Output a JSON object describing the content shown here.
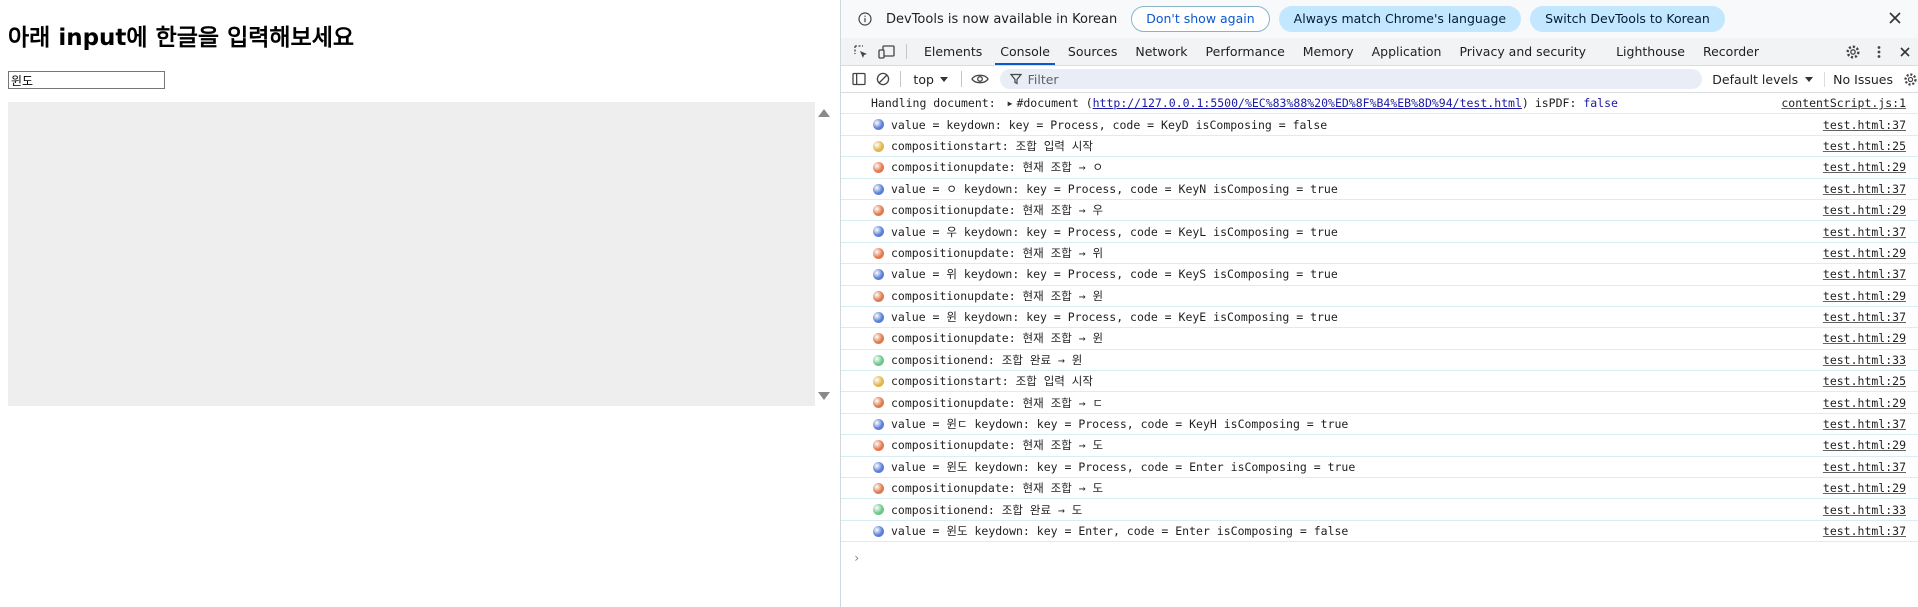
{
  "page": {
    "heading": "아래 input에 한글을 입력해보세요",
    "input_value": "윈도"
  },
  "devtools": {
    "infobar": {
      "message": "DevTools is now available in Korean",
      "dont_show_label": "Don't show again",
      "match_language_label": "Always match Chrome's language",
      "switch_label": "Switch DevTools to Korean"
    },
    "tabs": [
      {
        "label": "Elements"
      },
      {
        "label": "Console"
      },
      {
        "label": "Sources"
      },
      {
        "label": "Network"
      },
      {
        "label": "Performance"
      },
      {
        "label": "Memory"
      },
      {
        "label": "Application"
      },
      {
        "label": "Privacy and security"
      },
      {
        "label": "Lighthouse"
      },
      {
        "label": "Recorder"
      }
    ],
    "active_tab": "Console",
    "toolbar": {
      "context": "top",
      "filter_placeholder": "Filter",
      "levels": "Default levels",
      "issues": "No Issues"
    },
    "doc_row": {
      "label": "Handling document:",
      "node": "#document (",
      "url": "http://127.0.0.1:5500/%EC%83%88%20%ED%8F%B4%EB%8D%94/test.html",
      "close_paren": ")",
      "ispdf_label": "isPDF:",
      "ispdf_value": "false",
      "source": "contentScript.js:1"
    },
    "colors": {
      "keydown": "#5b7fd6",
      "compositionstart": "#e0b64a",
      "compositionupdate": "#e07a4e",
      "compositionend": "#6cc78a",
      "accent": "#0b57d0"
    },
    "logs": [
      {
        "kind": "keydown",
        "text": "value =  keydown: key = Process, code = KeyD isComposing = false",
        "source": "test.html:37"
      },
      {
        "kind": "compositionstart",
        "text": "compositionstart: 조합 입력 시작",
        "source": "test.html:25"
      },
      {
        "kind": "compositionupdate",
        "text": "compositionupdate: 현재 조합 → ㅇ",
        "source": "test.html:29"
      },
      {
        "kind": "keydown",
        "text": "value = ㅇ keydown: key = Process, code = KeyN isComposing = true",
        "source": "test.html:37"
      },
      {
        "kind": "compositionupdate",
        "text": "compositionupdate: 현재 조합 → 우",
        "source": "test.html:29"
      },
      {
        "kind": "keydown",
        "text": "value = 우 keydown: key = Process, code = KeyL isComposing = true",
        "source": "test.html:37"
      },
      {
        "kind": "compositionupdate",
        "text": "compositionupdate: 현재 조합 → 위",
        "source": "test.html:29"
      },
      {
        "kind": "keydown",
        "text": "value = 위 keydown: key = Process, code = KeyS isComposing = true",
        "source": "test.html:37"
      },
      {
        "kind": "compositionupdate",
        "text": "compositionupdate: 현재 조합 → 윈",
        "source": "test.html:29"
      },
      {
        "kind": "keydown",
        "text": "value = 윈 keydown: key = Process, code = KeyE isComposing = true",
        "source": "test.html:37"
      },
      {
        "kind": "compositionupdate",
        "text": "compositionupdate: 현재 조합 → 윈",
        "source": "test.html:29"
      },
      {
        "kind": "compositionend",
        "text": "compositionend: 조합 완료 → 윈",
        "source": "test.html:33"
      },
      {
        "kind": "compositionstart",
        "text": "compositionstart: 조합 입력 시작",
        "source": "test.html:25"
      },
      {
        "kind": "compositionupdate",
        "text": "compositionupdate: 현재 조합 → ㄷ",
        "source": "test.html:29"
      },
      {
        "kind": "keydown",
        "text": "value = 윈ㄷ keydown: key = Process, code = KeyH isComposing = true",
        "source": "test.html:37"
      },
      {
        "kind": "compositionupdate",
        "text": "compositionupdate: 현재 조합 → 도",
        "source": "test.html:29"
      },
      {
        "kind": "keydown",
        "text": "value = 윈도 keydown: key = Process, code = Enter isComposing = true",
        "source": "test.html:37"
      },
      {
        "kind": "compositionupdate",
        "text": "compositionupdate: 현재 조합 → 도",
        "source": "test.html:29"
      },
      {
        "kind": "compositionend",
        "text": "compositionend: 조합 완료 → 도",
        "source": "test.html:33"
      },
      {
        "kind": "keydown",
        "text": "value = 윈도 keydown: key = Enter, code = Enter isComposing = false",
        "source": "test.html:37"
      }
    ],
    "prompt_symbol": "›"
  }
}
